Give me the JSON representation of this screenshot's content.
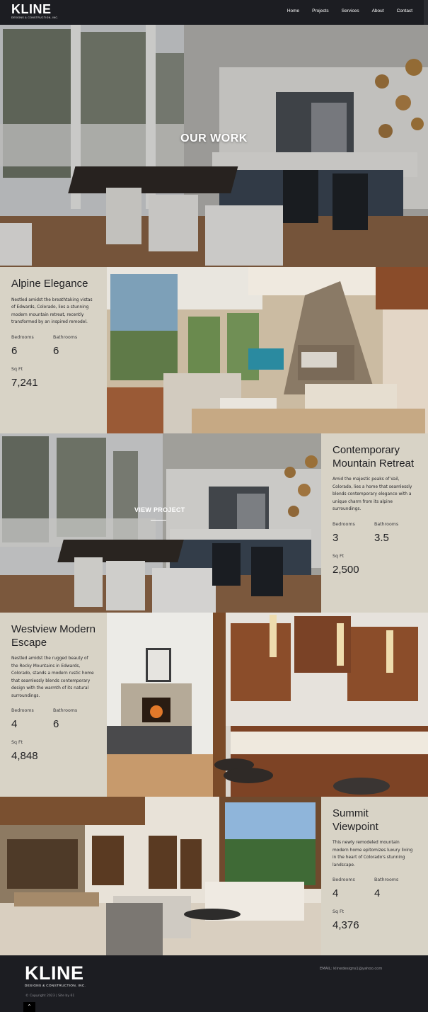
{
  "brand": {
    "name": "KLINE",
    "tagline": "DESIGNS & CONSTRUCTION, INC."
  },
  "nav": [
    "Home",
    "Projects",
    "Services",
    "About",
    "Contact"
  ],
  "hero": {
    "title": "OUR WORK"
  },
  "projects": [
    {
      "title": "Alpine Elegance",
      "description": "Nestled amidst the breathtaking vistas of Edwards, Colorado, lies a stunning modern mountain retreat, recently transformed by an inspired remodel.",
      "bedrooms_label": "Bedrooms",
      "bedrooms": "6",
      "bathrooms_label": "Bathrooms",
      "bathrooms": "6",
      "sqft_label": "Sq Ft",
      "sqft": "7,241"
    },
    {
      "title": "Contemporary Mountain Retreat",
      "description": "Amid the majestic peaks of Vail, Colorado, lies a home that seamlessly blends contemporary elegance with a unique charm from its alpine surroundings.",
      "bedrooms_label": "Bedrooms",
      "bedrooms": "3",
      "bathrooms_label": "Bathrooms",
      "bathrooms": "3.5",
      "sqft_label": "Sq Ft",
      "sqft": "2,500",
      "overlay": "VIEW PROJECT"
    },
    {
      "title": "Westview Modern Escape",
      "description": "Nestled amidst the rugged beauty of the Rocky Mountains in Edwards, Colorado, stands a modern rustic home that seamlessly blends contemporary design with the warmth of its natural surroundings.",
      "bedrooms_label": "Bedrooms",
      "bedrooms": "4",
      "bathrooms_label": "Bathrooms",
      "bathrooms": "6",
      "sqft_label": "Sq Ft",
      "sqft": "4,848"
    },
    {
      "title": "Summit Viewpoint",
      "description": "This newly remodeled mountain modern home epitomizes luxury living in the heart of Colorado's stunning landscape.",
      "bedrooms_label": "Bedrooms",
      "bedrooms": "4",
      "bathrooms_label": "Bathrooms",
      "bathrooms": "4",
      "sqft_label": "Sq Ft",
      "sqft": "4,376"
    }
  ],
  "footer": {
    "email": "EMAIL: klinedesigns1@yahoo.com",
    "copyright": "© Copyright 2023 | Site by 61",
    "to_top_icon": "chevron-up-icon"
  },
  "colors": {
    "dark": "#1c1d22",
    "card": "#d8d3c6",
    "text": "#1f1f22"
  }
}
